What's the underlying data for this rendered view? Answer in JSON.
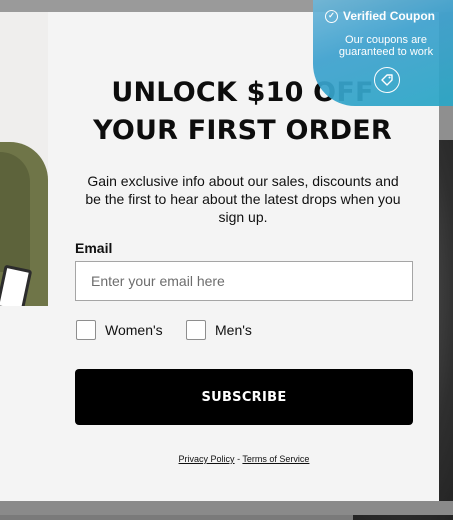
{
  "popup": {
    "headline_line1": "UNLOCK $10 OFF",
    "headline_line2": "YOUR FIRST ORDER",
    "description": "Gain exclusive info about our sales, discounts and be the first to hear about the latest drops when you sign up.",
    "email_label": "Email",
    "email_placeholder": "Enter your email here",
    "email_value": "",
    "checkbox_womens": "Women's",
    "checkbox_mens": "Men's",
    "subscribe_label": "SUBSCRIBE",
    "privacy_link": "Privacy Policy",
    "separator": " - ",
    "terms_link": "Terms of Service"
  },
  "coupon_badge": {
    "title": "Verified Coupon",
    "text": "Our coupons are guaranteed to work",
    "icon": "tag-icon",
    "check_icon": "check-circle-icon",
    "color": "#3fa2cf"
  },
  "colors": {
    "button_bg": "#000000",
    "modal_bg": "#f4f4f4"
  }
}
